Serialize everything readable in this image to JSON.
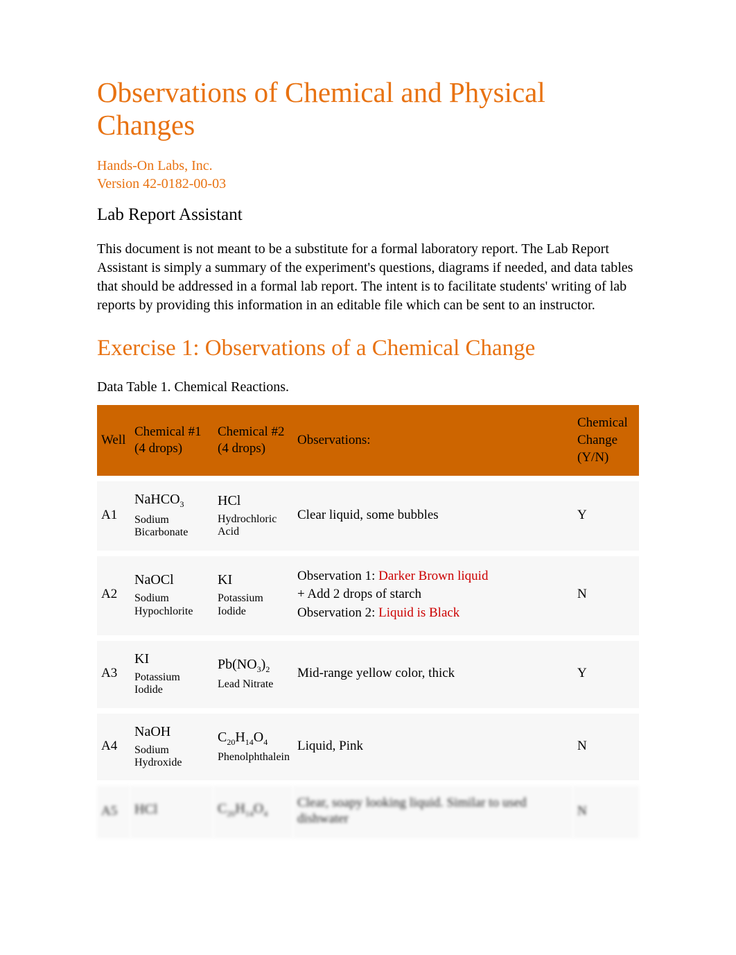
{
  "title": "Observations of Chemical and Physical Changes",
  "company": "Hands-On Labs, Inc.",
  "version": "Version 42-0182-00-03",
  "subtitle": "Lab Report Assistant",
  "description": "This document is not meant to be a substitute for a formal laboratory report. The Lab Report Assistant is simply a summary of the experiment's questions, diagrams if needed, and data tables that should be addressed in a formal lab report. The intent is to facilitate students' writing of lab reports by providing this information in an editable file which can be sent to an instructor.",
  "exercise_title": "Exercise 1: Observations of a Chemical Change",
  "table_caption": "Data Table 1.  Chemical Reactions.",
  "headers": {
    "well": "Well",
    "chem1": "Chemical #1 (4 drops)",
    "chem2": "Chemical #2 (4 drops)",
    "observations": "Observations:",
    "change": "Chemical Change (Y/N)"
  },
  "rows": [
    {
      "well": "A1",
      "chem1_formula": "NaHCO",
      "chem1_sub": "3",
      "chem1_name": "Sodium Bicarbonate",
      "chem2_formula": "HCl",
      "chem2_name": "Hydrochloric Acid",
      "observation": "Clear liquid, some bubbles",
      "change": "Y"
    },
    {
      "well": "A2",
      "chem1_formula": "NaOCl",
      "chem1_name": "Sodium Hypochlorite",
      "chem2_formula": "KI",
      "chem2_name": "Potassium Iodide",
      "obs1_label": "Observation 1:",
      "obs1_value": "Darker Brown liquid",
      "obs_mid": "+ Add 2 drops of starch",
      "obs2_label": "Observation 2:",
      "obs2_value": "Liquid is Black",
      "change": "N"
    },
    {
      "well": "A3",
      "chem1_formula": "KI",
      "chem1_name": "Potassium Iodide",
      "chem2_prefix": "Pb(NO",
      "chem2_sub1": "3",
      "chem2_mid": ")",
      "chem2_sub2": "2",
      "chem2_name": "Lead Nitrate",
      "observation": "Mid-range yellow color, thick",
      "change": "Y"
    },
    {
      "well": "A4",
      "chem1_formula": "NaOH",
      "chem1_name": "Sodium Hydroxide",
      "chem2_prefix": "C",
      "chem2_sub1": "20",
      "chem2_mid1": "H",
      "chem2_sub2": "14",
      "chem2_mid2": "O",
      "chem2_sub3": "4",
      "chem2_name": "Phenolphthalein",
      "observation": "Liquid, Pink",
      "change": "N"
    },
    {
      "well": "A5",
      "chem1_formula": "HCl",
      "chem1_name": "",
      "chem2_prefix": "C",
      "chem2_sub1": "20",
      "chem2_mid1": "H",
      "chem2_sub2": "14",
      "chem2_mid2": "O",
      "chem2_sub3": "4",
      "chem2_name": "",
      "observation": " Clear, soapy looking liquid. Similar to used dishwater",
      "change": "N"
    }
  ]
}
